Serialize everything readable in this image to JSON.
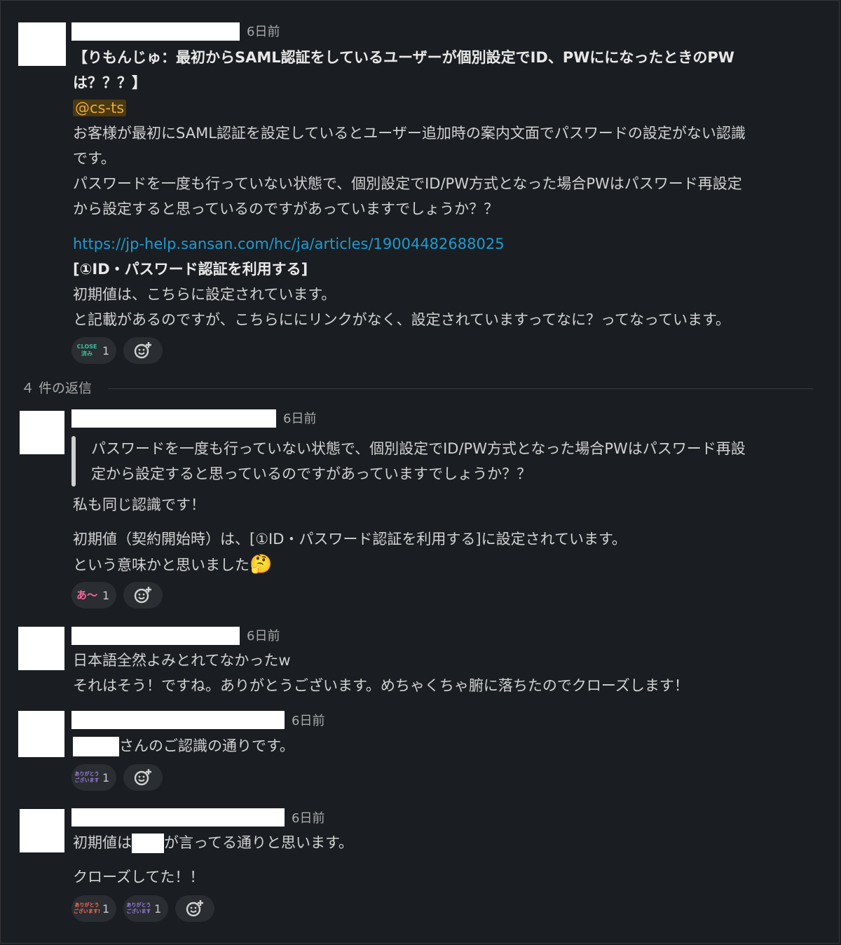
{
  "parent": {
    "time": "6日前",
    "title_1": "【りもんじゅ：最初からSAML認証をしているユーザーが個別設定でID、PWにになったときのPW",
    "title_2": "は？？？】",
    "mention": "@cs-ts",
    "body": [
      "お客様が最初にSAML認証を設定しているとユーザー追加時の案内文面でパスワードの設定がない認識",
      "です。",
      "パスワードを一度も行っていない状態で、個別設定でID/PW方式となった場合PWはパスワード再設定",
      "から設定すると思っているのですがあっていますでしょうか？？"
    ],
    "link": "https://jp-help.sansan.com/hc/ja/articles/19004482688025",
    "quote_title": "[①ID・パスワード認証を利用する]",
    "body2": [
      "初期値は、こちらに設定されています。",
      "と記載があるのですが、こちらににリンクがなく、設定されていますってなに？ってなっています。"
    ],
    "reaction": {
      "emoji_text": "CLOSE\n済み",
      "count": "1"
    }
  },
  "replies_divider": "４ 件の返信",
  "reply1": {
    "time": "6日前",
    "quote": [
      "パスワードを一度も行っていない状態で、個別設定でID/PW方式となった場合PWはパスワード再設",
      "定から設定すると思っているのですがあっていますでしょうか？？"
    ],
    "line1": "私も同じ認識です！",
    "line2": "初期値（契約開始時）は、[①ID・パスワード認証を利用する]に設定されています。",
    "line3": "という意味かと思いました",
    "thinking_emoji": "🤔",
    "reaction": {
      "emoji_text": "あ〜",
      "count": "1"
    }
  },
  "reply2": {
    "time": "6日前",
    "line1": "日本語全然よみとれてなかったw",
    "line2": "それはそう！ですね。ありがとうございます。めちゃくちゃ腑に落ちたのでクローズします！"
  },
  "reply3": {
    "time": "6日前",
    "line1_suffix": "さんのご認識の通りです。",
    "reaction": {
      "emoji_text": "ありがとう\nございます",
      "count": "1"
    }
  },
  "reply4": {
    "time": "6日前",
    "line1_prefix": "初期値は",
    "line1_suffix": "が言ってる通りと思います。",
    "line2": "クローズしてた！！",
    "reaction_a": {
      "emoji_text": "ありがとう\nございます!",
      "count": "1"
    },
    "reaction_b": {
      "emoji_text": "ありがとう\nございます",
      "count": "1"
    }
  },
  "colors": {
    "background": "#1a1d21",
    "link": "#1d9bd1",
    "mention_text": "#e8a83a",
    "mention_bg": "#4a3a12"
  },
  "icons": {
    "add_reaction": "add-reaction-icon",
    "thinking": "thinking-face-icon"
  }
}
